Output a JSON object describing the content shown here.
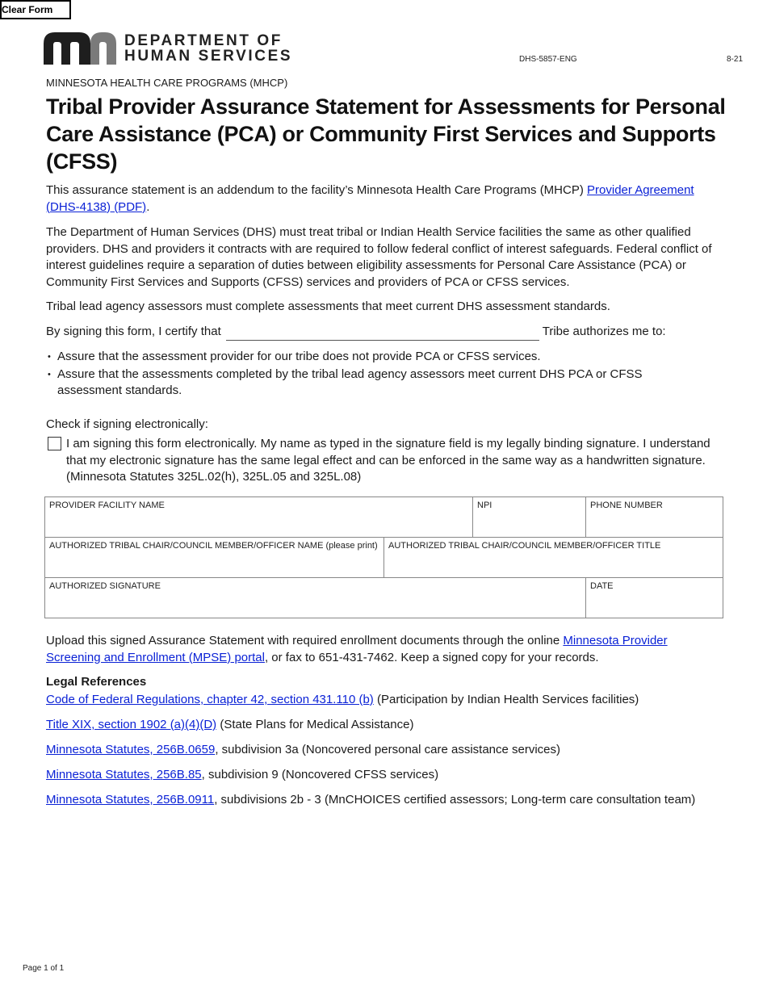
{
  "toolbar": {
    "clear_form_label": "Clear Form"
  },
  "header": {
    "logo_icon": "mn-logo-icon",
    "org_line1": "DEPARTMENT OF",
    "org_line2": "HUMAN SERVICES",
    "form_id": "DHS-5857-ENG",
    "form_date": "8-21",
    "program": "MINNESOTA HEALTH CARE PROGRAMS (MHCP)",
    "title": "Tribal Provider Assurance Statement for Assessments for Personal Care Assistance (PCA) or Community First Services and Supports (CFSS)"
  },
  "intro": {
    "p1_text": "This assurance statement is an addendum to the facility’s Minnesota Health Care Programs (MHCP) ",
    "p1_link": "Provider Agreement (DHS-4138) (PDF)",
    "p1_end": ".",
    "p2": "The Department of Human Services (DHS) must treat tribal or Indian Health Service facilities the same as other qualified providers. DHS and providers it contracts with are required to follow federal conflict of interest safeguards. Federal conflict of interest guidelines require a separation of duties between eligibility assessments for Personal Care Assistance (PCA) or Community First Services and Supports (CFSS) services and providers of PCA or CFSS services.",
    "p3": "Tribal lead agency assessors must complete assessments that meet current DHS assessment standards."
  },
  "certify": {
    "prefix": "By signing this form, I certify that",
    "tribe_value": "",
    "suffix": "Tribe authorizes me to:"
  },
  "bullets": [
    "Assure that the assessment provider for our tribe does not provide PCA or CFSS services.",
    "Assure that the assessments completed by the tribal lead agency assessors meet current DHS PCA or CFSS assessment standards."
  ],
  "esign": {
    "heading": "Check if signing electronically:",
    "checked": false,
    "text": "I am signing this form electronically. My name as typed in the signature field is my legally binding signature. I understand that my electronic signature has the same legal effect and can be enforced in the same way as a handwritten signature. (Minnesota Statutes 325L.02(h), 325L.05 and 325L.08)"
  },
  "fields": {
    "provider_facility_name": {
      "label": "PROVIDER FACILITY NAME",
      "value": ""
    },
    "npi": {
      "label": "NPI",
      "value": ""
    },
    "phone_number": {
      "label": "PHONE NUMBER",
      "value": ""
    },
    "officer_name": {
      "label": "AUTHORIZED TRIBAL CHAIR/COUNCIL MEMBER/OFFICER NAME (please print)",
      "value": ""
    },
    "officer_title": {
      "label": "AUTHORIZED TRIBAL CHAIR/COUNCIL MEMBER/OFFICER TITLE",
      "value": ""
    },
    "signature": {
      "label": "AUTHORIZED SIGNATURE",
      "value": ""
    },
    "date": {
      "label": "DATE",
      "value": ""
    }
  },
  "upload": {
    "text": "Upload this signed Assurance Statement with required enrollment documents through the online ",
    "link": "Minnesota Provider Screening and Enrollment (MPSE) portal",
    "end": ", or fax to 651-431-7462. Keep a signed copy for your records."
  },
  "legal": {
    "heading": "Legal References",
    "refs": [
      {
        "link": "Code of Federal Regulations, chapter 42, section 431.110 (b)",
        "text": " (Participation by Indian Health Services facilities)"
      },
      {
        "link": "Title XIX, section 1902 (a)(4)(D)",
        "text": " (State Plans for Medical Assistance)"
      },
      {
        "link": "Minnesota Statutes, 256B.0659",
        "text": ", subdivision 3a (Noncovered personal care assistance services)"
      },
      {
        "link": "Minnesota Statutes, 256B.85",
        "text": ", subdivision 9 (Noncovered CFSS services)"
      },
      {
        "link": "Minnesota Statutes, 256B.0911",
        "text": ", subdivisions 2b - 3 (MnCHOICES certified assessors; Long-term care consultation team)"
      }
    ]
  },
  "footer": {
    "page": "Page 1 of 1"
  },
  "colors": {
    "link": "#0b22d6",
    "logo_dark": "#1e1e1e",
    "logo_gray": "#7a7a7a"
  }
}
